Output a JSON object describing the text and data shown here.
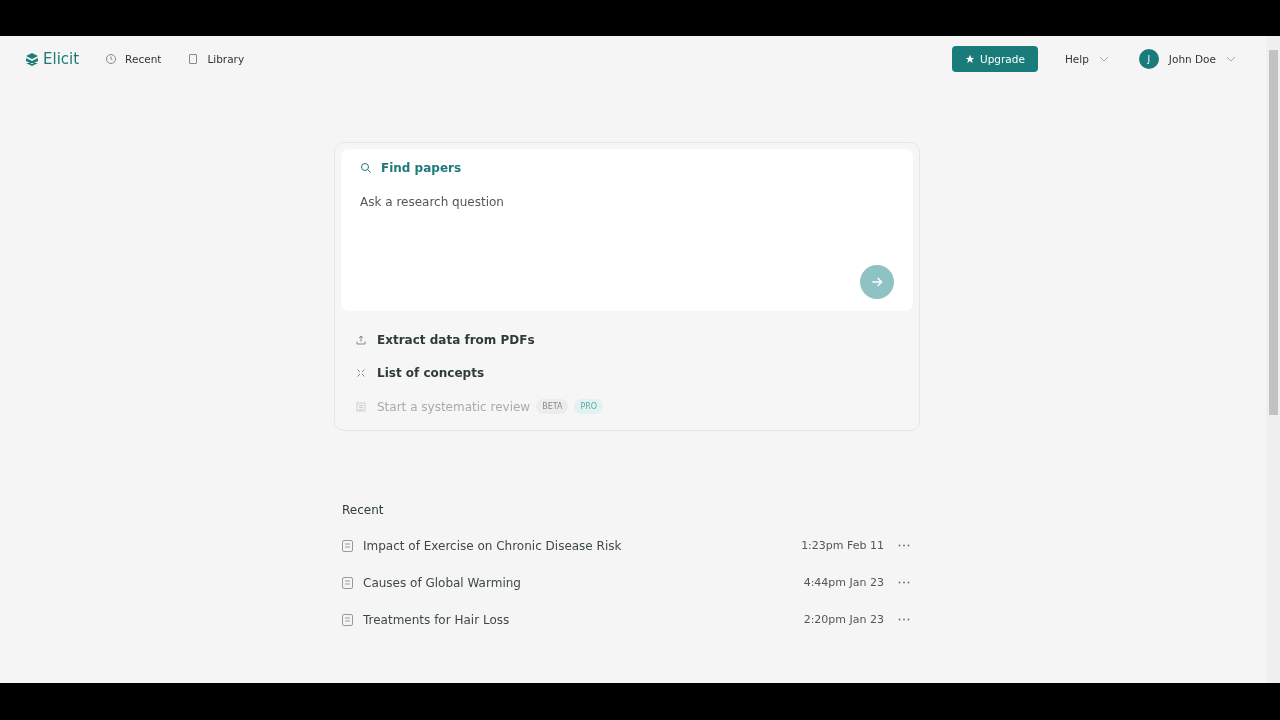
{
  "header": {
    "logo": "Elicit",
    "nav": [
      {
        "label": "Recent"
      },
      {
        "label": "Library"
      }
    ],
    "upgrade": "Upgrade",
    "help": "Help",
    "user": {
      "initial": "J",
      "name": "John Doe"
    }
  },
  "search": {
    "mode": "Find papers",
    "placeholder": "Ask a research question"
  },
  "actions": [
    {
      "label": "Extract data from PDFs",
      "disabled": false
    },
    {
      "label": "List of concepts",
      "disabled": false
    },
    {
      "label": "Start a systematic review",
      "disabled": true,
      "badges": [
        {
          "label": "BETA",
          "kind": "beta"
        },
        {
          "label": "PRO",
          "kind": "pro"
        }
      ]
    }
  ],
  "recent": {
    "title": "Recent",
    "items": [
      {
        "title": "Impact of Exercise on Chronic Disease Risk",
        "time": "1:23pm Feb 11"
      },
      {
        "title": "Causes of Global Warming",
        "time": "4:44pm Jan 23"
      },
      {
        "title": "Treatments for Hair Loss",
        "time": "2:20pm Jan 23"
      }
    ]
  }
}
